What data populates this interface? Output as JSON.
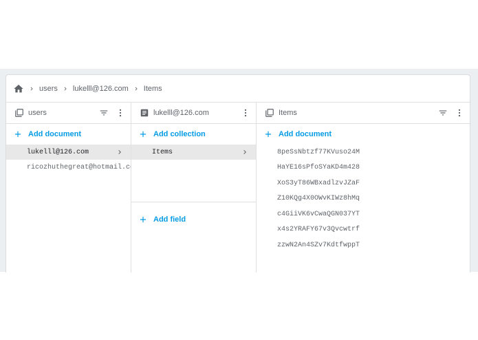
{
  "breadcrumb": {
    "items": [
      "users",
      "lukelll@126.com",
      "Items"
    ]
  },
  "columns": {
    "users": {
      "title": "users",
      "add_label": "Add document",
      "documents": [
        "lukelll@126.com",
        "ricozhuthegreat@hotmail.co"
      ],
      "selected_index": 0
    },
    "doc": {
      "title": "lukelll@126.com",
      "add_collection_label": "Add collection",
      "collections": [
        "Items"
      ],
      "add_field_label": "Add field"
    },
    "items": {
      "title": "Items",
      "add_label": "Add document",
      "documents": [
        "8peSsNbtzf77KVuso24M",
        "HaYE16sPfoSYaKD4m428",
        "XoS3yT86WBxadlzvJZaF",
        "Z10KQg4X0OWvKIWz8hMq",
        "c4GiiVK6vCwaQGN037YT",
        "x4s2YRAFY67v3Qvcwtrf",
        "zzwN2An4SZv7KdtfwppT"
      ]
    }
  },
  "colors": {
    "accent": "#039be5",
    "selected_bg": "#e8e8e8",
    "icon": "#5f6368"
  },
  "icons": [
    "home-icon",
    "chevron-right-icon",
    "collection-icon",
    "document-icon",
    "filter-icon",
    "more-vert-icon",
    "plus-icon"
  ]
}
